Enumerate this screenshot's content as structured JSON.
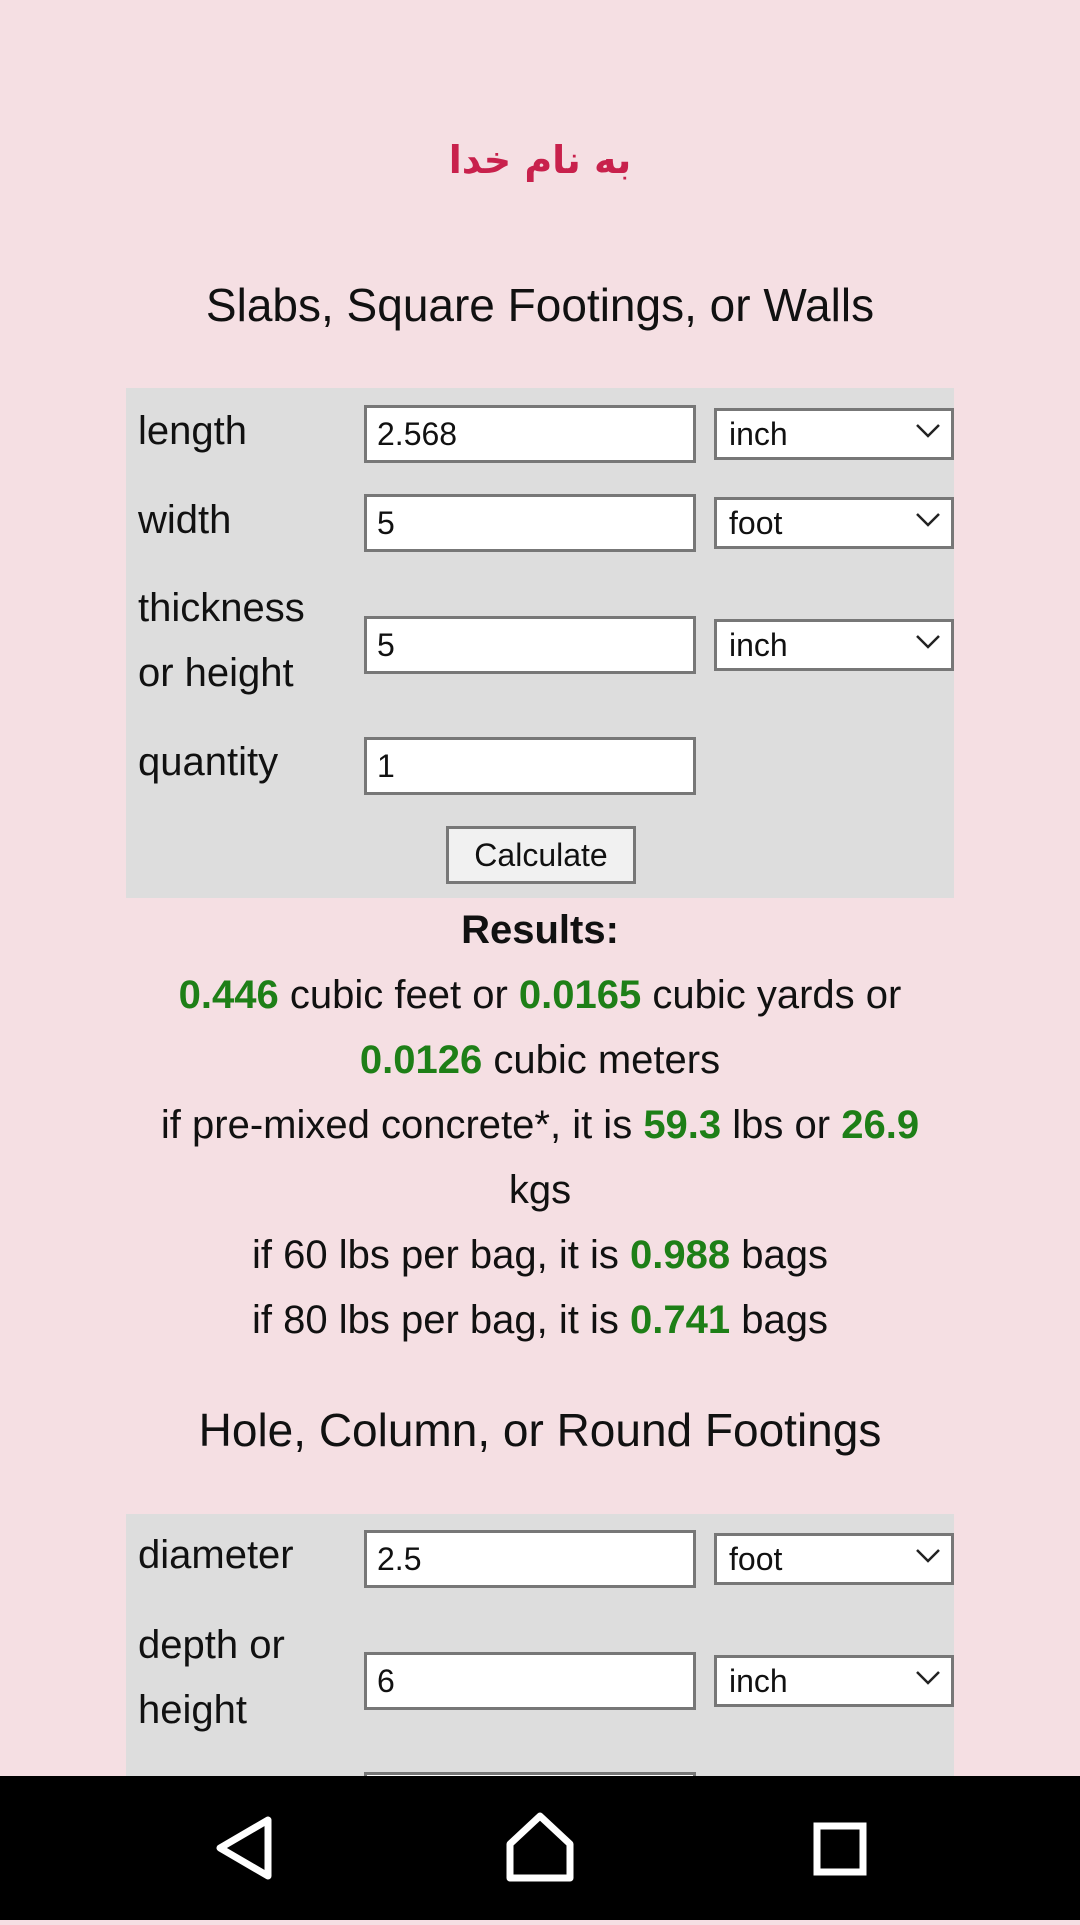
{
  "header": {
    "blessing": "به نام خدا"
  },
  "slabs": {
    "title": "Slabs, Square Footings, or Walls",
    "length_label": "length",
    "length_value": "2.568",
    "length_unit": "inch",
    "width_label": "width",
    "width_value": "5",
    "width_unit": "foot",
    "thickness_label_line1": "thickness",
    "thickness_label_line2": "or height",
    "thickness_value": "5",
    "thickness_unit": "inch",
    "quantity_label": "quantity",
    "quantity_value": "1",
    "calculate_label": "Calculate"
  },
  "results": {
    "heading": "Results:",
    "cubic_feet": "0.446",
    "cubic_feet_text": " cubic feet or ",
    "cubic_yards": "0.0165",
    "cubic_yards_text": " cubic yards or",
    "cubic_meters": "0.0126",
    "cubic_meters_text": " cubic meters",
    "premix_prefix": "if pre-mixed concrete*, it is ",
    "lbs": "59.3",
    "lbs_text": " lbs or ",
    "kgs": "26.9",
    "kgs_text": "kgs",
    "bag60_prefix": "if 60 lbs per bag, it is ",
    "bag60_value": "0.988",
    "bag60_suffix": " bags",
    "bag80_prefix": "if 80 lbs per bag, it is ",
    "bag80_value": "0.741",
    "bag80_suffix": " bags"
  },
  "round": {
    "title": "Hole, Column, or Round Footings",
    "diameter_label": "diameter",
    "diameter_value": "2.5",
    "diameter_unit": "foot",
    "depth_label_line1": "depth or",
    "depth_label_line2": "height",
    "depth_value": "6",
    "depth_unit": "inch"
  },
  "colors": {
    "background": "#f5dfe3",
    "panel": "#dddddd",
    "accent_header": "#c8214c",
    "result_value": "#1e7f17"
  },
  "nav": {
    "back_icon": "back-triangle-icon",
    "home_icon": "home-icon",
    "recents_icon": "recents-square-icon"
  }
}
